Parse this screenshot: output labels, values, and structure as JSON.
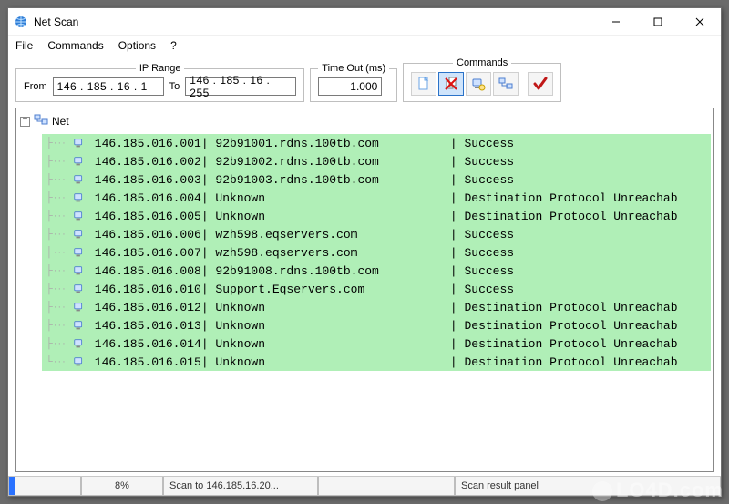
{
  "window": {
    "title": "Net Scan"
  },
  "menu": {
    "file": "File",
    "commands": "Commands",
    "options": "Options",
    "help": "?"
  },
  "toolbar": {
    "ip_range_label": "IP Range",
    "from_label": "From",
    "to_label": "To",
    "ip_from": "146 . 185 .  16 .    1",
    "ip_to": "146 . 185 .  16 . 255",
    "timeout_label": "Time Out (ms)",
    "timeout_value": "1.000",
    "commands_label": "Commands",
    "icons": {
      "new": "new-document-icon",
      "stop": "stop-scan-icon",
      "host": "host-icon",
      "network": "network-icon",
      "check": "check-icon"
    }
  },
  "tree": {
    "root_label": "Net"
  },
  "rows": [
    {
      "ip": "146.185.016.001",
      "host": "92b91001.rdns.100tb.com",
      "status": "Success"
    },
    {
      "ip": "146.185.016.002",
      "host": "92b91002.rdns.100tb.com",
      "status": "Success"
    },
    {
      "ip": "146.185.016.003",
      "host": "92b91003.rdns.100tb.com",
      "status": "Success"
    },
    {
      "ip": "146.185.016.004",
      "host": "Unknown",
      "status": "Destination Protocol Unreachab"
    },
    {
      "ip": "146.185.016.005",
      "host": "Unknown",
      "status": "Destination Protocol Unreachab"
    },
    {
      "ip": "146.185.016.006",
      "host": "wzh598.eqservers.com",
      "status": "Success"
    },
    {
      "ip": "146.185.016.007",
      "host": "wzh598.eqservers.com",
      "status": "Success"
    },
    {
      "ip": "146.185.016.008",
      "host": "92b91008.rdns.100tb.com",
      "status": "Success"
    },
    {
      "ip": "146.185.016.010",
      "host": "Support.Eqservers.com",
      "status": "Success"
    },
    {
      "ip": "146.185.016.012",
      "host": "Unknown",
      "status": "Destination Protocol Unreachab"
    },
    {
      "ip": "146.185.016.013",
      "host": "Unknown",
      "status": "Destination Protocol Unreachab"
    },
    {
      "ip": "146.185.016.014",
      "host": "Unknown",
      "status": "Destination Protocol Unreachab"
    },
    {
      "ip": "146.185.016.015",
      "host": "Unknown",
      "status": "Destination Protocol Unreachab"
    }
  ],
  "status": {
    "progress_pct": 8,
    "pct_text": "8%",
    "scan_to": "Scan to 146.185.16.20...",
    "panel_label": "Scan result panel"
  },
  "watermark": "LO4D.com",
  "colors": {
    "row_bg": "#b0efb7",
    "accent": "#2a72ff"
  }
}
